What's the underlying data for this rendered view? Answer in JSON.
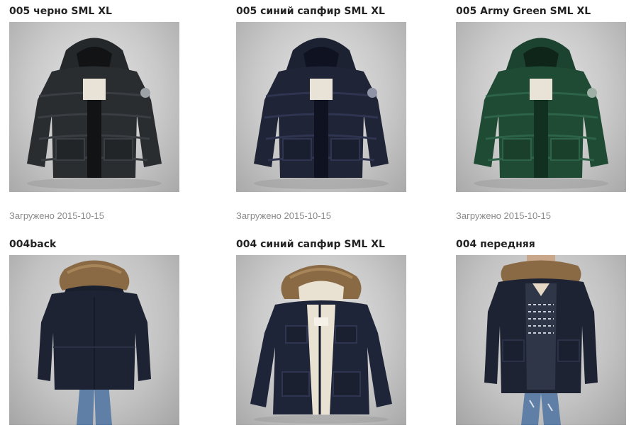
{
  "gallery": {
    "items": [
      {
        "title": "005 черно SML XL",
        "color_name": "black",
        "jacket_color": "#2a2d30",
        "uploaded": "Загружено 2015-10-15"
      },
      {
        "title": "005 синий сапфир SML XL",
        "color_name": "navy",
        "jacket_color": "#1f2436",
        "uploaded": "Загружено 2015-10-15"
      },
      {
        "title": "005 Army Green SML XL",
        "color_name": "army-green",
        "jacket_color": "#1f4a33",
        "uploaded": "Загружено 2015-10-15"
      },
      {
        "title": "004back",
        "color_name": "navy",
        "jacket_color": "#1e2333"
      },
      {
        "title": "004 синий сапфир SML XL",
        "color_name": "navy",
        "jacket_color": "#1f2538"
      },
      {
        "title": "004 передняя",
        "color_name": "navy",
        "jacket_color": "#1e2333"
      }
    ]
  },
  "colors": {
    "title_text": "#222222",
    "date_text": "#8a8a8a",
    "fur_trim": "#8a6a45",
    "sherpa_lining": "#e9e1d2",
    "denim": "#5f7fa6"
  }
}
